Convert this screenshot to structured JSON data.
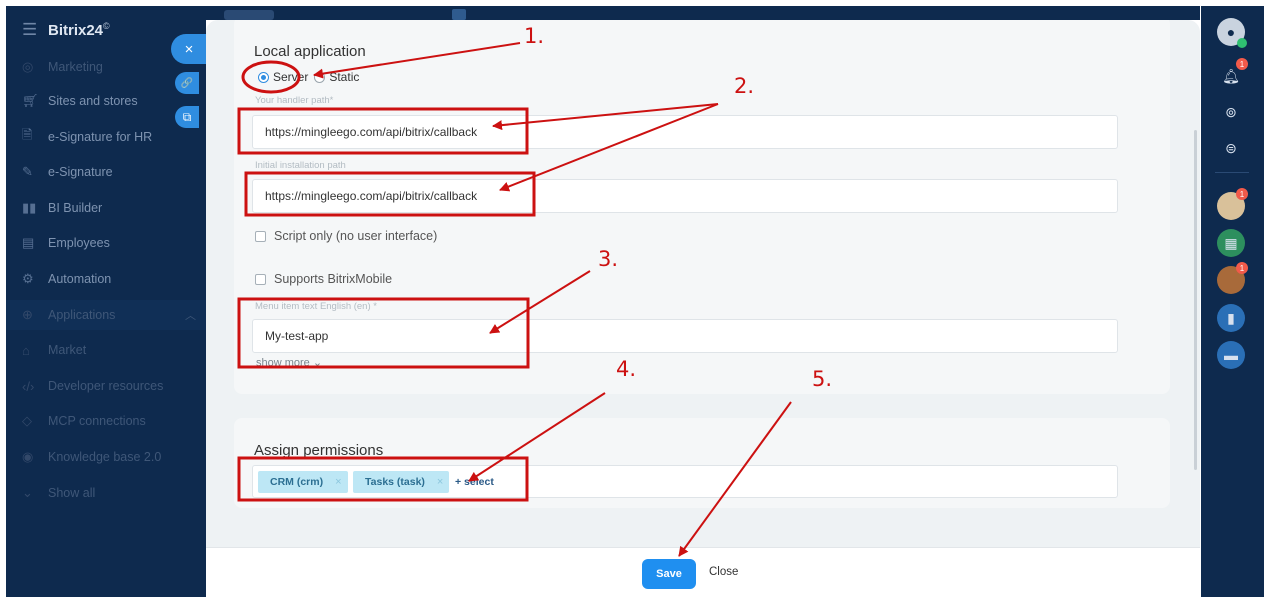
{
  "sidebar": {
    "logo": "Bitrix24",
    "logo_mark": "©",
    "items": [
      {
        "label": "Marketing",
        "icon": "target-icon"
      },
      {
        "label": "Sites and stores",
        "icon": "cart-icon"
      },
      {
        "label": "e-Signature for HR",
        "icon": "document-sign-icon"
      },
      {
        "label": "e-Signature",
        "icon": "pen-icon"
      },
      {
        "label": "BI Builder",
        "icon": "bar-chart-icon"
      },
      {
        "label": "Employees",
        "icon": "employees-icon"
      },
      {
        "label": "Automation",
        "icon": "automation-icon"
      },
      {
        "label": "Applications",
        "icon": "apps-icon"
      },
      {
        "label": "Market",
        "icon": "market-icon"
      },
      {
        "label": "Developer resources",
        "icon": "code-icon"
      },
      {
        "label": "MCP connections",
        "icon": "mcp-icon"
      },
      {
        "label": "Knowledge base 2.0",
        "icon": "knowledge-icon"
      },
      {
        "label": "Show all",
        "icon": "chevron-down-icon"
      }
    ]
  },
  "slider_buttons": {
    "close": "×",
    "link": "🔗",
    "open_new": "⧉"
  },
  "form": {
    "section_title": "Local application",
    "radio_server": "Server",
    "radio_static": "Static",
    "handler_label": "Your handler path*",
    "handler_value": "https://mingleego.com/api/bitrix/callback",
    "install_label": "Initial installation path",
    "install_value": "https://mingleego.com/api/bitrix/callback",
    "script_only": "Script only (no user interface)",
    "supports_mobile": "Supports BitrixMobile",
    "menu_label": "Menu item text English (en) *",
    "menu_value": "My-test-app",
    "show_more": "show more ⌄"
  },
  "permissions": {
    "title": "Assign permissions",
    "tags": [
      "CRM (crm)",
      "Tasks (task)"
    ],
    "remove_glyph": "×",
    "select_label": "+ select"
  },
  "footer": {
    "save": "Save",
    "close": "Close"
  },
  "rightbar": {
    "notifications_badge": "1",
    "avatar1_badge": "1",
    "avatar2_badge": "1"
  },
  "annotations": [
    "1.",
    "2.",
    "3.",
    "4.",
    "5."
  ],
  "colors": {
    "annotation": "#cc1111",
    "accent": "#1f8ff0",
    "sidebar": "#0e2a4e",
    "tag": "#bde7f5"
  }
}
